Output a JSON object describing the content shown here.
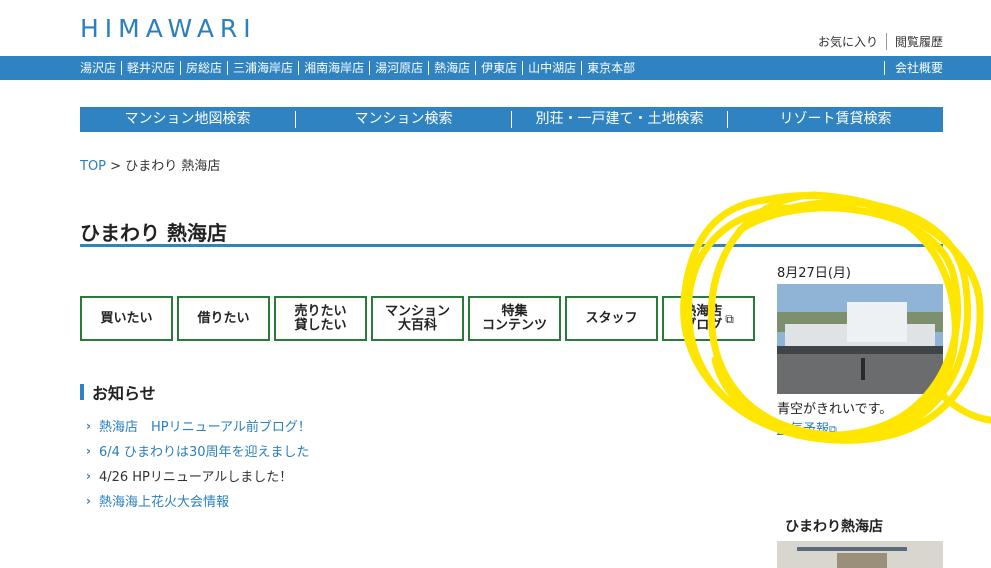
{
  "header": {
    "logo": "HIMAWARI",
    "util": {
      "favorites": "お気に入り",
      "history": "閲覧履歴"
    }
  },
  "stores": [
    "湯沢店",
    "軽井沢店",
    "房総店",
    "三浦海岸店",
    "湘南海岸店",
    "湯河原店",
    "熱海店",
    "伊東店",
    "山中湖店",
    "東京本部"
  ],
  "corporate": "会社概要",
  "search_nav": [
    "マンション地図検索",
    "マンション検索",
    "別荘・一戸建て・土地検索",
    "リゾート賃貸検索"
  ],
  "breadcrumb": {
    "top": "TOP",
    "sep": " > ",
    "current": "ひまわり 熱海店"
  },
  "page_title": "ひまわり 熱海店",
  "categories": [
    {
      "line1": "買いたい",
      "line2": ""
    },
    {
      "line1": "借りたい",
      "line2": ""
    },
    {
      "line1": "売りたい",
      "line2": "貸したい"
    },
    {
      "line1": "マンション",
      "line2": "大百科"
    },
    {
      "line1": "特集",
      "line2": "コンテンツ"
    },
    {
      "line1": "スタッフ",
      "line2": ""
    },
    {
      "line1": "熱海店",
      "line2": "ブログ"
    }
  ],
  "news": {
    "heading": "お知らせ",
    "items": [
      "熱海店　HPリニューアル前ブログ！",
      "6/4 ひまわりは30周年を迎えました",
      "4/26 HPリニューアルしました！",
      "熱海海上花火大会情報"
    ]
  },
  "sidebar": {
    "date": "8月27日(月)",
    "caption": "青空がきれいです。",
    "weather_link": "天気予報",
    "store_title": "ひまわり熱海店"
  },
  "colors": {
    "brand_blue": "#2f83c0",
    "button_border": "#2a7a3a",
    "highlight_scribble": "#ffe600"
  },
  "icons": {
    "external": "external-link-icon",
    "chevron": "chevron-right-icon"
  }
}
